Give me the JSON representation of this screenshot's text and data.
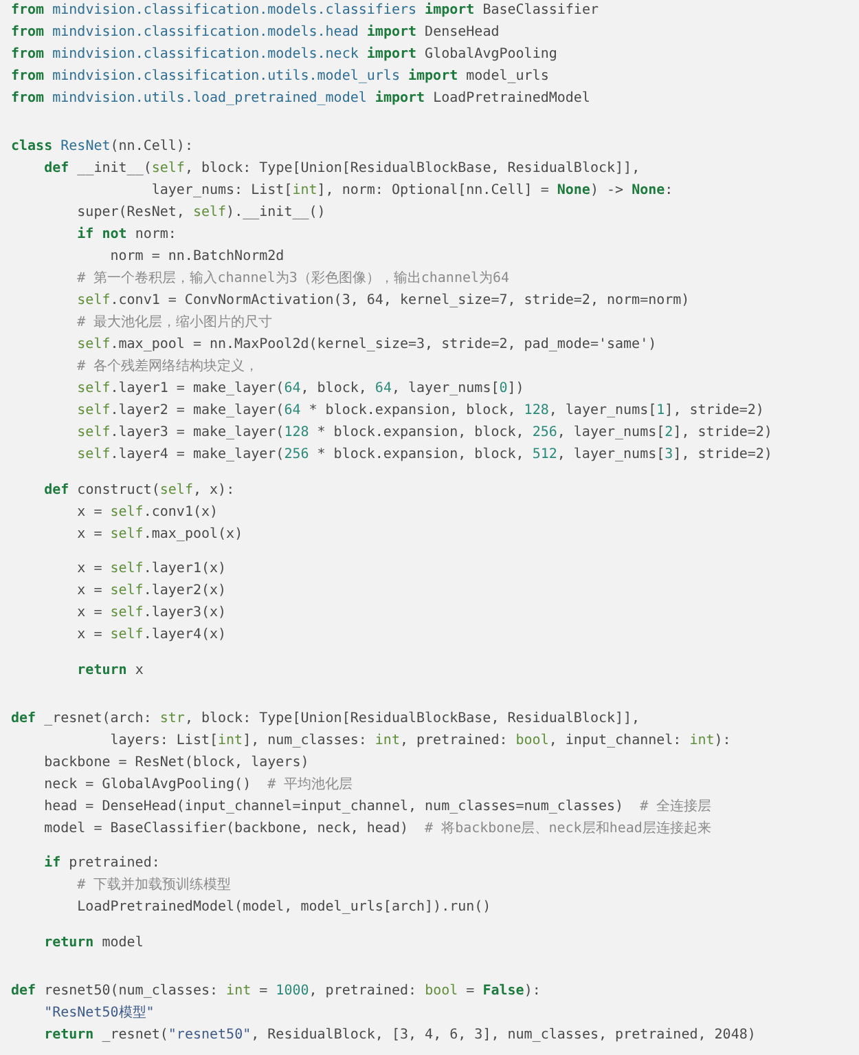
{
  "code_lines": [
    {
      "kind": "code",
      "tokens": [
        {
          "kind": "keyword",
          "text": "from"
        },
        {
          "kind": "module",
          "text": " mindvision.classification.models.classifiers "
        },
        {
          "kind": "keyword",
          "text": "import"
        },
        {
          "kind": "plain",
          "text": " BaseClassifier"
        }
      ]
    },
    {
      "kind": "code",
      "tokens": [
        {
          "kind": "keyword",
          "text": "from"
        },
        {
          "kind": "module",
          "text": " mindvision.classification.models.head "
        },
        {
          "kind": "keyword",
          "text": "import"
        },
        {
          "kind": "plain",
          "text": " DenseHead"
        }
      ]
    },
    {
      "kind": "code",
      "tokens": [
        {
          "kind": "keyword",
          "text": "from"
        },
        {
          "kind": "module",
          "text": " mindvision.classification.models.neck "
        },
        {
          "kind": "keyword",
          "text": "import"
        },
        {
          "kind": "plain",
          "text": " GlobalAvgPooling"
        }
      ]
    },
    {
      "kind": "code",
      "tokens": [
        {
          "kind": "keyword",
          "text": "from"
        },
        {
          "kind": "module",
          "text": " mindvision.classification.utils.model_urls "
        },
        {
          "kind": "keyword",
          "text": "import"
        },
        {
          "kind": "plain",
          "text": " model_urls"
        }
      ]
    },
    {
      "kind": "code",
      "tokens": [
        {
          "kind": "keyword",
          "text": "from"
        },
        {
          "kind": "module",
          "text": " mindvision.utils.load_pretrained_model "
        },
        {
          "kind": "keyword",
          "text": "import"
        },
        {
          "kind": "plain",
          "text": " LoadPretrainedModel"
        }
      ]
    },
    {
      "kind": "blank"
    },
    {
      "kind": "blank"
    },
    {
      "kind": "code",
      "tokens": [
        {
          "kind": "keyword",
          "text": "class"
        },
        {
          "kind": "module",
          "text": " ResNet"
        },
        {
          "kind": "plain",
          "text": "(nn.Cell):"
        }
      ]
    },
    {
      "kind": "code",
      "tokens": [
        {
          "kind": "keyword",
          "text": "    def"
        },
        {
          "kind": "plain",
          "text": " __init__("
        },
        {
          "kind": "builtin",
          "text": "self"
        },
        {
          "kind": "plain",
          "text": ", block: Type[Union[ResidualBlockBase, ResidualBlock]],"
        }
      ]
    },
    {
      "kind": "code",
      "tokens": [
        {
          "kind": "plain",
          "text": "                 layer_nums: List["
        },
        {
          "kind": "builtin",
          "text": "int"
        },
        {
          "kind": "plain",
          "text": "], norm: Optional[nn.Cell] = "
        },
        {
          "kind": "keyword",
          "text": "None"
        },
        {
          "kind": "plain",
          "text": ") -> "
        },
        {
          "kind": "keyword",
          "text": "None"
        },
        {
          "kind": "plain",
          "text": ":"
        }
      ]
    },
    {
      "kind": "code",
      "tokens": [
        {
          "kind": "plain",
          "text": "        super(ResNet, "
        },
        {
          "kind": "builtin",
          "text": "self"
        },
        {
          "kind": "plain",
          "text": ").__init__()"
        }
      ]
    },
    {
      "kind": "code",
      "tokens": [
        {
          "kind": "keyword",
          "text": "        if"
        },
        {
          "kind": "keyword",
          "text": " not"
        },
        {
          "kind": "plain",
          "text": " norm:"
        }
      ]
    },
    {
      "kind": "code",
      "tokens": [
        {
          "kind": "plain",
          "text": "            norm = nn.BatchNorm2d"
        }
      ]
    },
    {
      "kind": "code",
      "tokens": [
        {
          "kind": "comment",
          "text": "        # 第一个卷积层，输入channel为3（彩色图像），输出channel为64"
        }
      ]
    },
    {
      "kind": "code",
      "tokens": [
        {
          "kind": "builtin",
          "text": "        self"
        },
        {
          "kind": "plain",
          "text": ".conv1 = ConvNormActivation(3, 64, kernel_size=7, stride=2, norm=norm)"
        }
      ]
    },
    {
      "kind": "code",
      "tokens": [
        {
          "kind": "comment",
          "text": "        # 最大池化层，缩小图片的尺寸"
        }
      ]
    },
    {
      "kind": "code",
      "tokens": [
        {
          "kind": "builtin",
          "text": "        self"
        },
        {
          "kind": "plain",
          "text": ".max_pool = nn.MaxPool2d(kernel_size=3, stride=2, pad_mode='same')"
        }
      ]
    },
    {
      "kind": "code",
      "tokens": [
        {
          "kind": "comment",
          "text": "        # 各个残差网络结构块定义，"
        }
      ]
    },
    {
      "kind": "code",
      "tokens": [
        {
          "kind": "builtin",
          "text": "        self"
        },
        {
          "kind": "plain",
          "text": ".layer1 = make_layer("
        },
        {
          "kind": "number",
          "text": "64"
        },
        {
          "kind": "plain",
          "text": ", block, "
        },
        {
          "kind": "number",
          "text": "64"
        },
        {
          "kind": "plain",
          "text": ", layer_nums["
        },
        {
          "kind": "number",
          "text": "0"
        },
        {
          "kind": "plain",
          "text": "])"
        }
      ]
    },
    {
      "kind": "code",
      "tokens": [
        {
          "kind": "builtin",
          "text": "        self"
        },
        {
          "kind": "plain",
          "text": ".layer2 = make_layer("
        },
        {
          "kind": "number",
          "text": "64"
        },
        {
          "kind": "plain",
          "text": " * block.expansion, block, "
        },
        {
          "kind": "number",
          "text": "128"
        },
        {
          "kind": "plain",
          "text": ", layer_nums["
        },
        {
          "kind": "number",
          "text": "1"
        },
        {
          "kind": "plain",
          "text": "], stride=2)"
        }
      ]
    },
    {
      "kind": "code",
      "tokens": [
        {
          "kind": "builtin",
          "text": "        self"
        },
        {
          "kind": "plain",
          "text": ".layer3 = make_layer("
        },
        {
          "kind": "number",
          "text": "128"
        },
        {
          "kind": "plain",
          "text": " * block.expansion, block, "
        },
        {
          "kind": "number",
          "text": "256"
        },
        {
          "kind": "plain",
          "text": ", layer_nums["
        },
        {
          "kind": "number",
          "text": "2"
        },
        {
          "kind": "plain",
          "text": "], stride=2)"
        }
      ]
    },
    {
      "kind": "code",
      "tokens": [
        {
          "kind": "builtin",
          "text": "        self"
        },
        {
          "kind": "plain",
          "text": ".layer4 = make_layer("
        },
        {
          "kind": "number",
          "text": "256"
        },
        {
          "kind": "plain",
          "text": " * block.expansion, block, "
        },
        {
          "kind": "number",
          "text": "512"
        },
        {
          "kind": "plain",
          "text": ", layer_nums["
        },
        {
          "kind": "number",
          "text": "3"
        },
        {
          "kind": "plain",
          "text": "], stride=2)"
        }
      ]
    },
    {
      "kind": "blank"
    },
    {
      "kind": "code",
      "tokens": [
        {
          "kind": "keyword",
          "text": "    def"
        },
        {
          "kind": "plain",
          "text": " construct("
        },
        {
          "kind": "builtin",
          "text": "self"
        },
        {
          "kind": "plain",
          "text": ", x):"
        }
      ]
    },
    {
      "kind": "code",
      "tokens": [
        {
          "kind": "plain",
          "text": "        x = "
        },
        {
          "kind": "builtin",
          "text": "self"
        },
        {
          "kind": "plain",
          "text": ".conv1(x)"
        }
      ]
    },
    {
      "kind": "code",
      "tokens": [
        {
          "kind": "plain",
          "text": "        x = "
        },
        {
          "kind": "builtin",
          "text": "self"
        },
        {
          "kind": "plain",
          "text": ".max_pool(x)"
        }
      ]
    },
    {
      "kind": "blank"
    },
    {
      "kind": "code",
      "tokens": [
        {
          "kind": "plain",
          "text": "        x = "
        },
        {
          "kind": "builtin",
          "text": "self"
        },
        {
          "kind": "plain",
          "text": ".layer1(x)"
        }
      ]
    },
    {
      "kind": "code",
      "tokens": [
        {
          "kind": "plain",
          "text": "        x = "
        },
        {
          "kind": "builtin",
          "text": "self"
        },
        {
          "kind": "plain",
          "text": ".layer2(x)"
        }
      ]
    },
    {
      "kind": "code",
      "tokens": [
        {
          "kind": "plain",
          "text": "        x = "
        },
        {
          "kind": "builtin",
          "text": "self"
        },
        {
          "kind": "plain",
          "text": ".layer3(x)"
        }
      ]
    },
    {
      "kind": "code",
      "tokens": [
        {
          "kind": "plain",
          "text": "        x = "
        },
        {
          "kind": "builtin",
          "text": "self"
        },
        {
          "kind": "plain",
          "text": ".layer4(x)"
        }
      ]
    },
    {
      "kind": "blank"
    },
    {
      "kind": "code",
      "tokens": [
        {
          "kind": "keyword",
          "text": "        return"
        },
        {
          "kind": "plain",
          "text": " x"
        }
      ]
    },
    {
      "kind": "blank"
    },
    {
      "kind": "blank"
    },
    {
      "kind": "code",
      "tokens": [
        {
          "kind": "keyword",
          "text": "def"
        },
        {
          "kind": "plain",
          "text": " _resnet(arch: "
        },
        {
          "kind": "builtin",
          "text": "str"
        },
        {
          "kind": "plain",
          "text": ", block: Type[Union[ResidualBlockBase, ResidualBlock]],"
        }
      ]
    },
    {
      "kind": "code",
      "tokens": [
        {
          "kind": "plain",
          "text": "            layers: List["
        },
        {
          "kind": "builtin",
          "text": "int"
        },
        {
          "kind": "plain",
          "text": "], num_classes: "
        },
        {
          "kind": "builtin",
          "text": "int"
        },
        {
          "kind": "plain",
          "text": ", pretrained: "
        },
        {
          "kind": "builtin",
          "text": "bool"
        },
        {
          "kind": "plain",
          "text": ", input_channel: "
        },
        {
          "kind": "builtin",
          "text": "int"
        },
        {
          "kind": "plain",
          "text": "):"
        }
      ]
    },
    {
      "kind": "code",
      "tokens": [
        {
          "kind": "plain",
          "text": "    backbone = ResNet(block, layers)"
        }
      ]
    },
    {
      "kind": "code",
      "tokens": [
        {
          "kind": "plain",
          "text": "    neck = GlobalAvgPooling()"
        },
        {
          "kind": "comment",
          "text": "  # 平均池化层"
        }
      ]
    },
    {
      "kind": "code",
      "tokens": [
        {
          "kind": "plain",
          "text": "    head = DenseHead(input_channel=input_channel, num_classes=num_classes)"
        },
        {
          "kind": "comment",
          "text": "  # 全连接层"
        }
      ]
    },
    {
      "kind": "code",
      "tokens": [
        {
          "kind": "plain",
          "text": "    model = BaseClassifier(backbone, neck, head)"
        },
        {
          "kind": "comment",
          "text": "  # 将backbone层、neck层和head层连接起来"
        }
      ]
    },
    {
      "kind": "blank"
    },
    {
      "kind": "code",
      "tokens": [
        {
          "kind": "keyword",
          "text": "    if"
        },
        {
          "kind": "plain",
          "text": " pretrained:"
        }
      ]
    },
    {
      "kind": "code",
      "tokens": [
        {
          "kind": "comment",
          "text": "        # 下载并加载预训练模型"
        }
      ]
    },
    {
      "kind": "code",
      "tokens": [
        {
          "kind": "plain",
          "text": "        LoadPretrainedModel(model, model_urls[arch]).run()"
        }
      ]
    },
    {
      "kind": "blank"
    },
    {
      "kind": "code",
      "tokens": [
        {
          "kind": "keyword",
          "text": "    return"
        },
        {
          "kind": "plain",
          "text": " model"
        }
      ]
    },
    {
      "kind": "blank"
    },
    {
      "kind": "blank"
    },
    {
      "kind": "code",
      "tokens": [
        {
          "kind": "keyword",
          "text": "def"
        },
        {
          "kind": "plain",
          "text": " resnet50(num_classes: "
        },
        {
          "kind": "builtin",
          "text": "int"
        },
        {
          "kind": "plain",
          "text": " = "
        },
        {
          "kind": "number",
          "text": "1000"
        },
        {
          "kind": "plain",
          "text": ", pretrained: "
        },
        {
          "kind": "builtin",
          "text": "bool"
        },
        {
          "kind": "plain",
          "text": " = "
        },
        {
          "kind": "keyword",
          "text": "False"
        },
        {
          "kind": "plain",
          "text": "):"
        }
      ]
    },
    {
      "kind": "code",
      "tokens": [
        {
          "kind": "string",
          "text": "    \"ResNet50模型\""
        }
      ]
    },
    {
      "kind": "code",
      "tokens": [
        {
          "kind": "keyword",
          "text": "    return"
        },
        {
          "kind": "plain",
          "text": " _resnet("
        },
        {
          "kind": "string",
          "text": "\"resnet50\""
        },
        {
          "kind": "plain",
          "text": ", ResidualBlock, [3, 4, 6, 3], num_classes, pretrained, 2048)"
        }
      ]
    }
  ]
}
